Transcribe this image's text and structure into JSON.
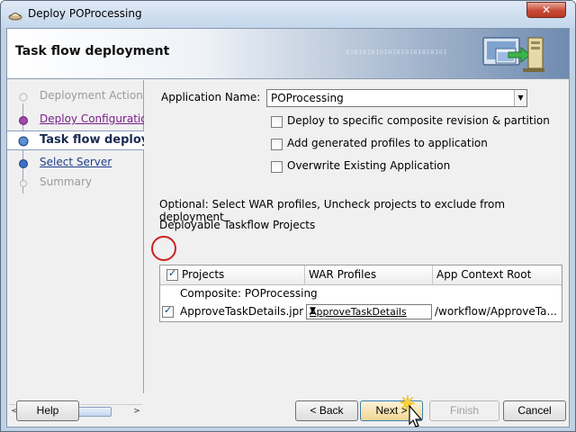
{
  "window": {
    "title": "Deploy POProcessing",
    "close_glyph": "✕"
  },
  "header": {
    "title": "Task flow deployment",
    "binary_text": "010101010101010101010101"
  },
  "sidebar": {
    "steps": [
      {
        "label": "Deployment Action",
        "state": "disabled"
      },
      {
        "label": "Deploy Configuration",
        "state": "visited"
      },
      {
        "label": "Task flow deployment",
        "state": "current"
      },
      {
        "label": "Select Server",
        "state": "link"
      },
      {
        "label": "Summary",
        "state": "disabled"
      }
    ],
    "scroll_left": "<",
    "scroll_right": ">"
  },
  "form": {
    "app_name_label": "Application Name:",
    "app_name_value": "POProcessing",
    "options": [
      {
        "label": "Deploy to specific composite revision & partition",
        "checked": false
      },
      {
        "label": "Add generated profiles to application",
        "checked": false
      },
      {
        "label": "Overwrite Existing Application",
        "checked": false
      }
    ],
    "optional_text": "Optional: Select WAR profiles, Uncheck projects to exclude from deployment",
    "projects_heading": "Deployable Taskflow Projects"
  },
  "table": {
    "columns": [
      "Projects",
      "WAR Profiles",
      "App Context Root"
    ],
    "header_checked": true,
    "group_label": "Composite:  POProcessing",
    "rows": [
      {
        "checked": true,
        "project": "ApproveTaskDetails.jpr",
        "war_profile": "ApproveTaskDetails",
        "context_root": "/workflow/ApproveTa..."
      }
    ]
  },
  "buttons": {
    "help": "Help",
    "back": "< Back",
    "next": "Next >",
    "finish": "Finish",
    "cancel": "Cancel"
  },
  "colors": {
    "accent_red": "#d02020",
    "link": "#1f3d8a",
    "visited": "#7a1f8a"
  }
}
